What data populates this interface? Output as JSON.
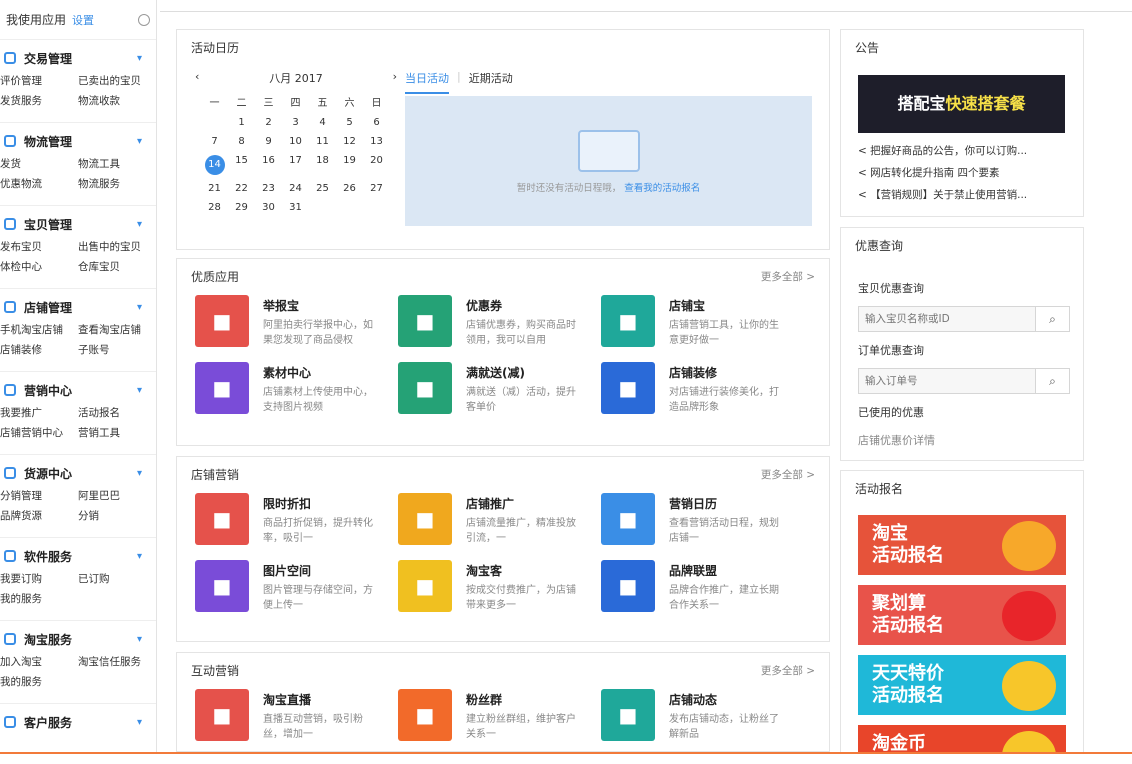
{
  "sidebar": {
    "header": {
      "title": "我使用应用",
      "custom": "设置"
    },
    "groups": [
      {
        "title": "交易管理",
        "items": [
          "评价管理",
          "已卖出的宝贝",
          "发货服务",
          "物流收款"
        ]
      },
      {
        "title": "物流管理",
        "items": [
          "发货",
          "物流工具",
          "优惠物流",
          "物流服务"
        ]
      },
      {
        "title": "宝贝管理",
        "items": [
          "发布宝贝",
          "出售中的宝贝",
          "体检中心",
          "仓库宝贝"
        ]
      },
      {
        "title": "店铺管理",
        "items": [
          "手机淘宝店铺",
          "查看淘宝店铺",
          "店铺装修",
          "子账号"
        ]
      },
      {
        "title": "营销中心",
        "items": [
          "我要推广",
          "活动报名",
          "店铺营销中心",
          "营销工具"
        ]
      },
      {
        "title": "货源中心",
        "items": [
          "分销管理",
          "阿里巴巴",
          "品牌货源",
          "分销"
        ]
      },
      {
        "title": "软件服务",
        "items": [
          "我要订购",
          "已订购",
          "我的服务"
        ]
      },
      {
        "title": "淘宝服务",
        "items": [
          "加入淘宝",
          "淘宝信任服务",
          "我的服务"
        ]
      },
      {
        "title": "客户服务",
        "items": []
      }
    ]
  },
  "calendar": {
    "title": "活动日历",
    "month": "八月 2017",
    "weekdays": [
      "一",
      "二",
      "三",
      "四",
      "五",
      "六",
      "日"
    ],
    "rows": [
      [
        "",
        "1",
        "2",
        "3",
        "4",
        "5",
        "6"
      ],
      [
        "7",
        "8",
        "9",
        "10",
        "11",
        "12",
        "13"
      ],
      [
        "14",
        "15",
        "16",
        "17",
        "18",
        "19",
        "20"
      ],
      [
        "21",
        "22",
        "23",
        "24",
        "25",
        "26",
        "27"
      ],
      [
        "28",
        "29",
        "30",
        "31",
        "",
        "",
        ""
      ]
    ],
    "today": "14",
    "tab_active": "当日活动",
    "tab_other": "近期活动",
    "empty_text": "暂时还没有活动日程哦，",
    "empty_link": "查看我的活动报名"
  },
  "recommended": {
    "title": "优质应用",
    "more": "更多全部 >",
    "apps": [
      {
        "name": "举报宝",
        "desc": "阿里拍卖行举报中心，如果您发现了商品侵权",
        "color": "#e5524b",
        "icon": "shield-icon"
      },
      {
        "name": "优惠券",
        "desc": "店铺优惠券，购买商品时领用，我可以自用",
        "color": "#25a276",
        "icon": "coupon-icon"
      },
      {
        "name": "店铺宝",
        "desc": "店铺营销工具，让你的生意更好做一",
        "color": "#1fa89a",
        "icon": "store-icon"
      },
      {
        "name": "素材中心",
        "desc": "店铺素材上传使用中心，支持图片视频",
        "color": "#7a4cd8",
        "icon": "puzzle-icon"
      },
      {
        "name": "满就送(减)",
        "desc": "满就送（减）活动，提升客单价",
        "color": "#25a276",
        "icon": "gift-icon"
      },
      {
        "name": "店铺装修",
        "desc": "对店铺进行装修美化，打造品牌形象",
        "color": "#2a6ad8",
        "icon": "document-icon"
      }
    ]
  },
  "shop_section": {
    "title": "店铺营销",
    "more": "更多全部 >",
    "apps": [
      {
        "name": "限时折扣",
        "desc": "商品打折促销，提升转化率，吸引一",
        "color": "#e5524b",
        "icon": "clock-icon"
      },
      {
        "name": "店铺推广",
        "desc": "店铺流量推广，精准投放引流，一",
        "color": "#f0a81e",
        "icon": "shop-icon"
      },
      {
        "name": "营销日历",
        "desc": "查看营销活动日程，规划店铺一",
        "color": "#3a8ee6",
        "icon": "calendar-icon"
      },
      {
        "name": "图片空间",
        "desc": "图片管理与存储空间，方便上传一",
        "color": "#7a4cd8",
        "icon": "image-icon"
      },
      {
        "name": "淘宝客",
        "desc": "按成交付费推广，为店铺带来更多一",
        "color": "#f0c020",
        "icon": "ticket-icon"
      },
      {
        "name": "品牌联盟",
        "desc": "品牌合作推广，建立长期合作关系一",
        "color": "#2a6ad8",
        "icon": "handshake-icon"
      }
    ]
  },
  "interact_section": {
    "title": "互动营销",
    "more": "更多全部 >",
    "apps": [
      {
        "name": "淘宝直播",
        "desc": "直播互动营销，吸引粉丝，增加一",
        "color": "#e5524b",
        "icon": "live-icon"
      },
      {
        "name": "粉丝群",
        "desc": "建立粉丝群组，维护客户关系一",
        "color": "#f26a2a",
        "icon": "broadcast-icon"
      },
      {
        "name": "店铺动态",
        "desc": "发布店铺动态，让粉丝了解新品",
        "color": "#1fa89a",
        "icon": "monitor-icon"
      }
    ]
  },
  "notice": {
    "title": "公告",
    "banner_white": "搭配宝",
    "banner_yellow": "快速搭套餐",
    "items": [
      "< 把握好商品的公告，你可以订购...",
      "< 网店转化提升指南 四个要素",
      "< 【营销规则】关于禁止使用营销..."
    ]
  },
  "tools": {
    "title": "优惠查询",
    "label1": "宝贝优惠查询",
    "placeholder1": "输入宝贝名称或ID",
    "label2": "订单优惠查询",
    "placeholder2": "输入订单号",
    "check1": "已使用的优惠",
    "check2": "店铺优惠价详情"
  },
  "activity": {
    "title": "活动报名",
    "promos": [
      {
        "line1": "淘宝",
        "line2": "活动报名",
        "color": "#e6533a",
        "mascot": "#f7a82a"
      },
      {
        "line1": "聚划算",
        "line2": "活动报名",
        "color": "#e8534a",
        "mascot": "#e8252a"
      },
      {
        "line1": "天天特价",
        "line2": "活动报名",
        "color": "#1fb8d8",
        "mascot": "#f7c62a"
      },
      {
        "line1": "淘金币",
        "line2": "",
        "color": "#e8452a",
        "mascot": "#f7c62a"
      }
    ]
  }
}
